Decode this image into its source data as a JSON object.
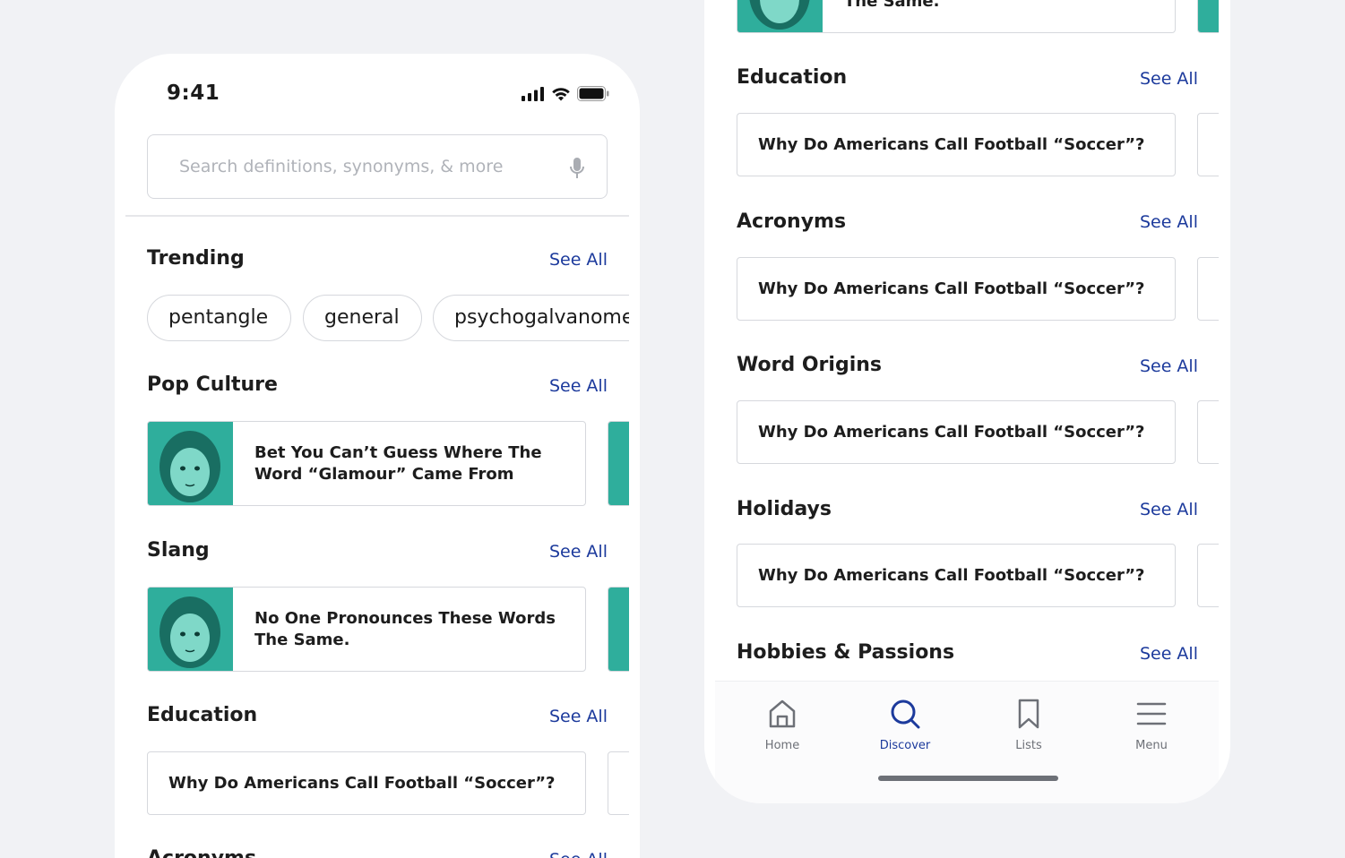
{
  "status_bar": {
    "time": "9:41"
  },
  "search": {
    "placeholder": "Search definitions, synonyms, & more"
  },
  "see_all_label": "See All",
  "left": {
    "sections": {
      "trending": "Trending",
      "pop_culture": "Pop Culture",
      "slang": "Slang",
      "education": "Education",
      "acronyms": "Acronyms"
    },
    "trending_chips": [
      "pentangle",
      "general",
      "psychogalvanometer"
    ],
    "pop_culture_card": "Bet You Can’t Guess Where The Word “Glamour” Came From",
    "slang_card": "No One Pronounces These Words The Same.",
    "education_card": "Why Do Americans Call Football “Soccer”?"
  },
  "right": {
    "top_card_tail": "The Same.",
    "sections": [
      {
        "title": "Education",
        "card": "Why Do Americans Call Football “Soccer”?"
      },
      {
        "title": "Acronyms",
        "card": "Why Do Americans Call Football “Soccer”?"
      },
      {
        "title": "Word Origins",
        "card": "Why Do Americans Call Football “Soccer”?"
      },
      {
        "title": "Holidays",
        "card": "Why Do Americans Call Football “Soccer”?"
      },
      {
        "title": "Hobbies & Passions"
      }
    ]
  },
  "tab_bar": {
    "items": [
      {
        "label": "Home",
        "icon": "home-icon"
      },
      {
        "label": "Discover",
        "icon": "search-icon",
        "active": true
      },
      {
        "label": "Lists",
        "icon": "bookmark-icon"
      },
      {
        "label": "Menu",
        "icon": "menu-icon"
      }
    ]
  },
  "colors": {
    "accent": "#1c3a9c",
    "thumbnail": "#2fae9c",
    "text": "#1d1d1d",
    "muted": "#6d7077"
  }
}
